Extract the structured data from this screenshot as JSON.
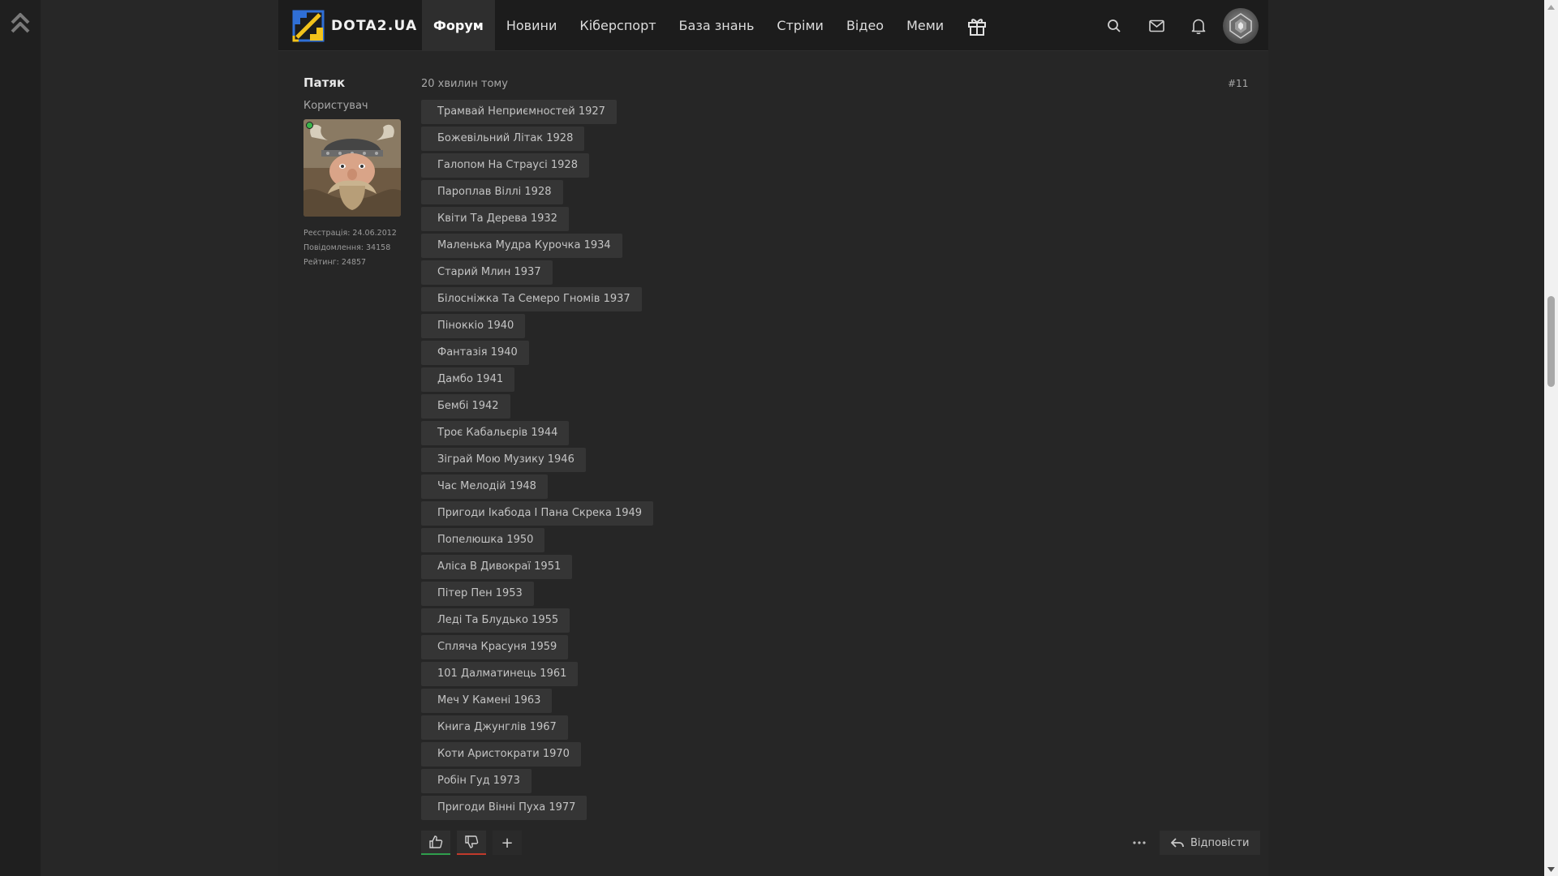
{
  "header": {
    "logo_text": "DOTA2.UA",
    "nav": [
      {
        "label": "Форум",
        "active": true
      },
      {
        "label": "Новини",
        "active": false
      },
      {
        "label": "Кіберспорт",
        "active": false
      },
      {
        "label": "База знань",
        "active": false
      },
      {
        "label": "Стріми",
        "active": false
      },
      {
        "label": "Відео",
        "active": false
      },
      {
        "label": "Меми",
        "active": false
      }
    ],
    "icons": [
      "gift-icon",
      "search-icon",
      "mail-icon",
      "bell-icon",
      "user-avatar"
    ]
  },
  "post": {
    "author": {
      "name": "Патяк",
      "role": "Користувач",
      "online": true,
      "registered": "Реєстрація: 24.06.2012",
      "messages": "Повідомлення: 34158",
      "rating": "Рейтинг: 24857"
    },
    "time": "20 хвилин тому",
    "number": "#11",
    "tags": [
      "Трамвай Неприємностей 1927",
      "Божевільний Літак 1928",
      "Галопом На Страусі 1928",
      "Пароплав Віллі 1928",
      "Квіти Та Дерева 1932",
      "Маленька Мудра Курочка 1934",
      "Старий Млин 1937",
      "Білосніжка Та Семеро Гномів 1937",
      "Піноккіо 1940",
      "Фантазія 1940",
      "Дамбо 1941",
      "Бембі 1942",
      "Троє Кабальєрів 1944",
      "Зіграй Мою Музику 1946",
      "Час Мелодій 1948",
      "Пригоди Ікабода І Пана Скрека 1949",
      "Попелюшка 1950",
      "Аліса В Дивокраї 1951",
      "Пітер Пен 1953",
      "Леді Та Блудько 1955",
      "Спляча Красуня 1959",
      "101 Далматинець 1961",
      "Меч У Камені 1963",
      "Книга Джунглів 1967",
      "Коти Аристократи 1970",
      "Робін Гуд 1973",
      "Пригоди Вінні Пуха 1977"
    ],
    "actions": {
      "reply_label": "Відповісти",
      "plus_label": "+"
    }
  },
  "colors": {
    "background": "#272727",
    "header": "#1c1c1c",
    "tag": "#353535",
    "like": "#2f9e4c",
    "dislike": "#c0392b",
    "online": "#3bb54a"
  }
}
